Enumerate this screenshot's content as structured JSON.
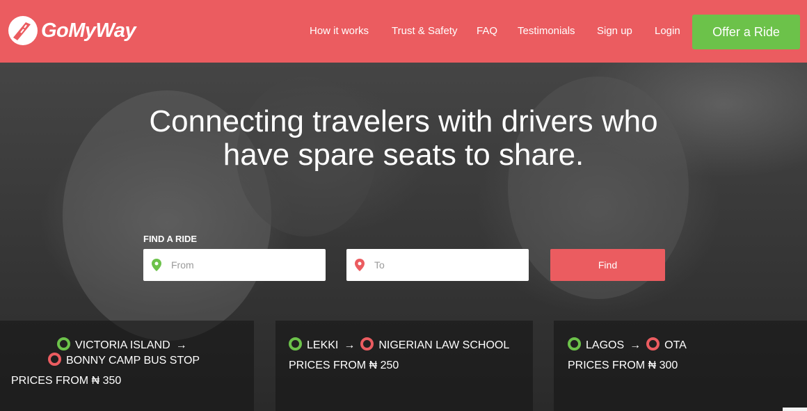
{
  "brand": {
    "name": "GoMyWay"
  },
  "nav": {
    "links": [
      "How it works",
      "Trust & Safety",
      "FAQ",
      "Testimonials",
      "Sign up",
      "Login"
    ],
    "cta": "Offer a Ride"
  },
  "hero": {
    "headline_line1": "Connecting travelers with drivers who",
    "headline_line2": "have spare seats to share."
  },
  "search": {
    "label": "FIND A RIDE",
    "from_placeholder": "From",
    "to_placeholder": "To",
    "button": "Find"
  },
  "routes": [
    {
      "from": "VICTORIA ISLAND",
      "arrow": "→",
      "to": "BONNY CAMP BUS STOP",
      "price": "PRICES FROM ₦ 350"
    },
    {
      "from": "LEKKI",
      "arrow": "→",
      "to": "NIGERIAN LAW SCHOOL",
      "price": "PRICES FROM ₦ 250"
    },
    {
      "from": "LAGOS",
      "arrow": "→",
      "to": "OTA",
      "price": "PRICES FROM ₦ 300"
    }
  ],
  "colors": {
    "brand": "#eb5c60",
    "cta": "#6cc24a",
    "origin": "#6cc24a",
    "destination": "#eb5c60"
  }
}
